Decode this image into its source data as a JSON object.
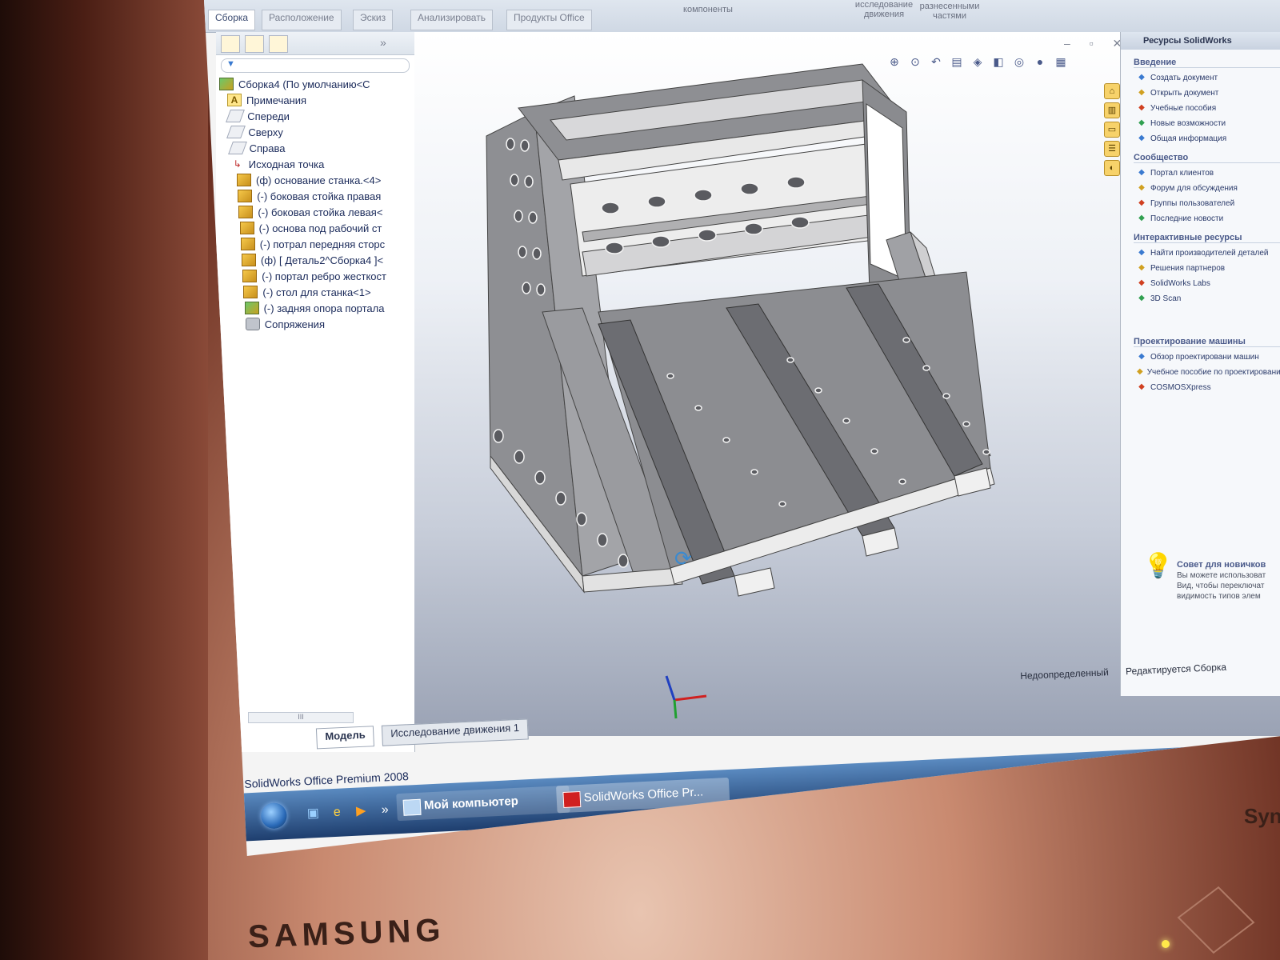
{
  "monitor": {
    "brand": "SAMSUNG",
    "brand_right": "Syn"
  },
  "ribbon": {
    "tabs": [
      "Сборка",
      "Расположение",
      "Эскиз",
      "Анализировать",
      "Продукты Office"
    ],
    "active_tab": 0,
    "labels": [
      "компоненты",
      "исследование движения",
      "разнесенными частями"
    ]
  },
  "tree": {
    "root": "Сборка4 (По умолчанию<С",
    "items": [
      {
        "label": "Примечания",
        "icon": "annotation-icon"
      },
      {
        "label": "Спереди",
        "icon": "plane-icon"
      },
      {
        "label": "Сверху",
        "icon": "plane-icon"
      },
      {
        "label": "Справа",
        "icon": "plane-icon"
      },
      {
        "label": "Исходная точка",
        "icon": "origin-icon"
      },
      {
        "label": "(ф) основание станка.<4>",
        "icon": "part-icon"
      },
      {
        "label": "(-) боковая стойка правая",
        "icon": "part-icon"
      },
      {
        "label": "(-) боковая стойка левая<",
        "icon": "part-icon"
      },
      {
        "label": "(-) основа под рабочий ст",
        "icon": "part-icon"
      },
      {
        "label": "(-) потрал передняя сторс",
        "icon": "part-icon"
      },
      {
        "label": "(ф) [ Деталь2^Сборка4 ]<",
        "icon": "part-icon"
      },
      {
        "label": "(-) портал ребро жесткост",
        "icon": "part-icon"
      },
      {
        "label": "(-) стол для станка<1>",
        "icon": "part-icon"
      },
      {
        "label": "(-) задняя опора портала",
        "icon": "subassembly-icon"
      },
      {
        "label": "Сопряжения",
        "icon": "mates-icon"
      }
    ]
  },
  "bottom_tabs": [
    "Модель",
    "Исследование движения 1"
  ],
  "scrollbar_label": "III",
  "taskpane": {
    "title": "Ресурсы SolidWorks",
    "sections": [
      {
        "title": "Введение",
        "items": [
          "Создать документ",
          "Открыть документ",
          "Учебные пособия",
          "Новые возможности",
          "Общая информация"
        ]
      },
      {
        "title": "Сообщество",
        "items": [
          "Портал клиентов",
          "Форум для обсуждения",
          "Группы пользователей",
          "Последние новости"
        ]
      },
      {
        "title": "Интерактивные ресурсы",
        "items": [
          "Найти производителей деталей",
          "Решения партнеров",
          "SolidWorks Labs",
          "3D Scan"
        ]
      },
      {
        "title": "Проектирование машины",
        "items": [
          "Обзор проектировани машин",
          "Учебное пособие по проектированию ма",
          "COSMOSXpress"
        ]
      }
    ],
    "tip_title": "Совет для новичков",
    "tip_text": "Вы можете использоват Вид, чтобы переключат видимость типов элем"
  },
  "status": {
    "state": "Недоопределенный",
    "mode": "Редактируется Сборка"
  },
  "app_title": "SolidWorks Office Premium 2008",
  "taskbar": {
    "items": [
      "Мой компьютер",
      "SolidWorks Office Pr..."
    ]
  },
  "colors": {
    "model_gray": "#8e8f93",
    "model_light": "#e6e6e6",
    "ribbon_bg": "#cfd8e4",
    "taskbar": "#1e3e6e"
  }
}
